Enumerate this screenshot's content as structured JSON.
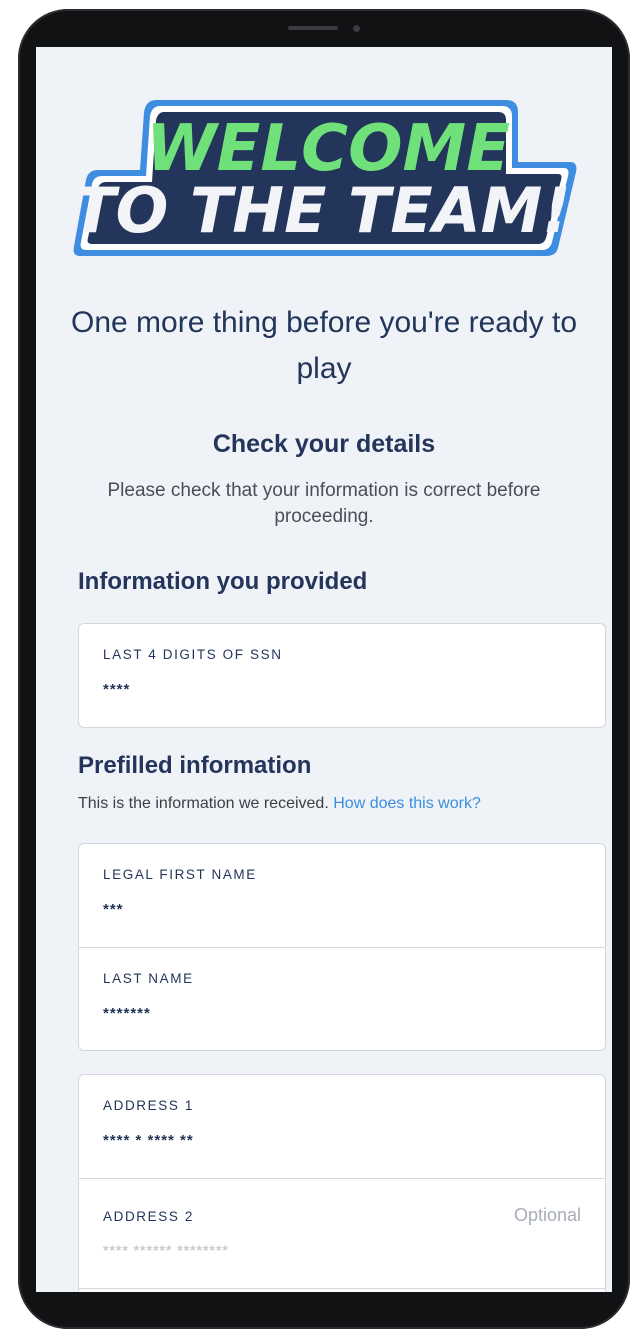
{
  "logo": {
    "line1": "WELCOME",
    "line2": "TO THE TEAM!"
  },
  "headline": "One more thing before you're ready to play",
  "check": {
    "title": "Check your details",
    "description": "Please check that your information is correct before proceeding."
  },
  "provided": {
    "title": "Information you provided",
    "fields": [
      {
        "label": "LAST 4 DIGITS OF SSN",
        "value": "****"
      }
    ]
  },
  "prefilled": {
    "title": "Prefilled information",
    "description": "This is the information we received.",
    "link": "How does this work?",
    "name_fields": [
      {
        "label": "LEGAL FIRST NAME",
        "value": "***"
      },
      {
        "label": "LAST NAME",
        "value": "*******"
      }
    ],
    "address_fields": [
      {
        "label": "ADDRESS 1",
        "value": "**** * **** **"
      },
      {
        "label": "ADDRESS 2",
        "optional": "Optional",
        "placeholder": "**** ****** ********"
      }
    ]
  },
  "colors": {
    "navy": "#23355a",
    "green": "#6fe07a",
    "blue_outline": "#3f8de0",
    "link": "#3b8ee0",
    "background": "#eff2f6"
  }
}
